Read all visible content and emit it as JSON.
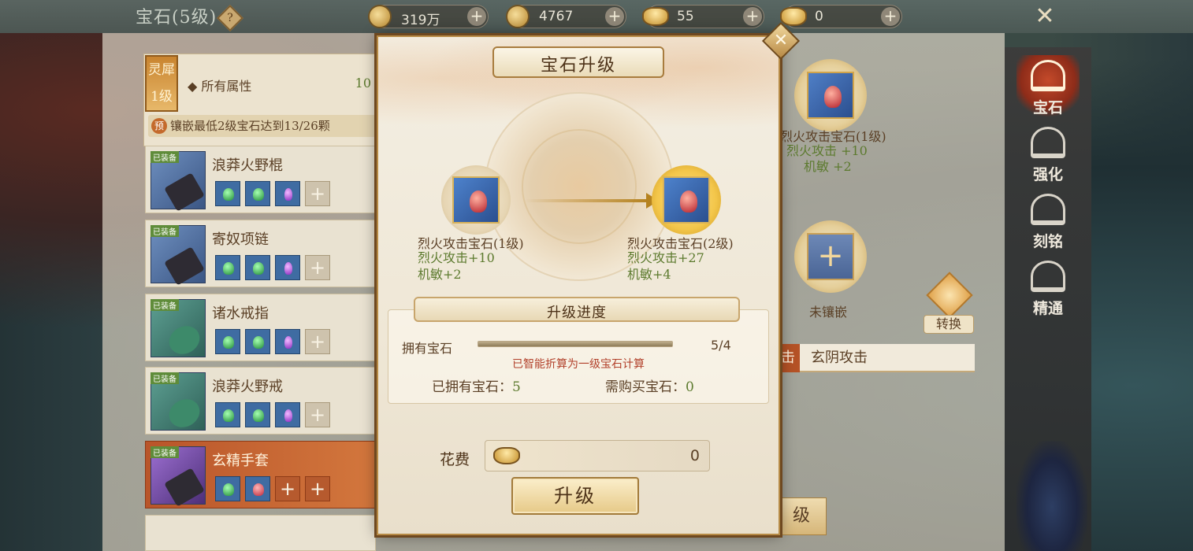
{
  "header": {
    "title": "宝石(5级)",
    "help": "?",
    "resources": [
      {
        "icon": "copper-coin-icon",
        "value": "319万"
      },
      {
        "icon": "gold-coin-icon",
        "value": "4767"
      },
      {
        "icon": "bound-ingot-icon",
        "value": "55"
      },
      {
        "icon": "gold-ingot-icon",
        "value": "0"
      }
    ],
    "add_label": "+",
    "close_label": "✕"
  },
  "attributes": {
    "badge_top": "灵犀",
    "badge_level": "1级",
    "label": "所有属性",
    "value": "10",
    "hint_icon": "预",
    "hint": "镶嵌最低2级宝石达到13/26颗"
  },
  "equipment": [
    {
      "badge": "已装备",
      "name": "浪莽火野棍",
      "slots": [
        "green",
        "green",
        "purple",
        "empty"
      ]
    },
    {
      "badge": "已装备",
      "name": "寄奴项链",
      "slots": [
        "green",
        "green",
        "purple",
        "empty"
      ]
    },
    {
      "badge": "已装备",
      "name": "诸水戒指",
      "slots": [
        "green",
        "green",
        "purple",
        "empty"
      ]
    },
    {
      "badge": "已装备",
      "name": "浪莽火野戒",
      "slots": [
        "green",
        "green",
        "purple",
        "empty"
      ]
    },
    {
      "badge": "已装备",
      "name": "玄精手套",
      "slots": [
        "green",
        "red",
        "empty",
        "empty"
      ],
      "selected": true
    }
  ],
  "right_panel": {
    "gem_name": "烈火攻击宝石(1级)",
    "gem_stat1": "烈火攻击 +10",
    "gem_stat2": "机敏 +2",
    "empty_slot_label": "未镶嵌",
    "convert_label": "转换",
    "tab_active": "击",
    "tab_other": "玄阴攻击",
    "bottom_button": "级"
  },
  "side_nav": [
    {
      "label": "宝石",
      "icon": "gem-nav-icon",
      "active": true
    },
    {
      "label": "强化",
      "icon": "enhance-nav-icon",
      "active": false
    },
    {
      "label": "刻铭",
      "icon": "engrave-nav-icon",
      "active": false
    },
    {
      "label": "精通",
      "icon": "mastery-nav-icon",
      "active": false
    }
  ],
  "dialog": {
    "title": "宝石升级",
    "close_label": "✕",
    "from": {
      "name": "烈火攻击宝石(1级)",
      "stat1": "烈火攻击+10",
      "stat2": "机敏+2"
    },
    "to": {
      "name": "烈火攻击宝石(2级)",
      "stat1": "烈火攻击+27",
      "stat2": "机敏+4"
    },
    "progress_title": "升级进度",
    "owned_label": "拥有宝石",
    "owned_value": "5/4",
    "owned_fraction": 1.0,
    "note": "已智能折算为一级宝石计算",
    "have_label": "已拥有宝石：",
    "have_value": "5",
    "need_label": "需购买宝石：",
    "need_value": "0",
    "cost_label": "花费",
    "cost_value": "0",
    "upgrade_button": "升级"
  }
}
